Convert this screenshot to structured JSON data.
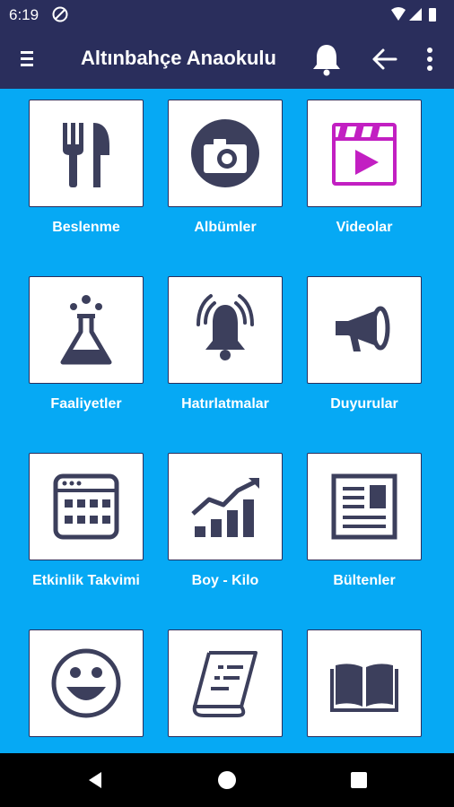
{
  "status_bar": {
    "time": "6:19"
  },
  "app_bar": {
    "title": "Altınbahçe Anaokulu"
  },
  "tiles": [
    {
      "label": "Beslenme",
      "icon": "fork-knife-icon"
    },
    {
      "label": "Albümler",
      "icon": "camera-icon"
    },
    {
      "label": "Videolar",
      "icon": "video-clapper-icon"
    },
    {
      "label": "Faaliyetler",
      "icon": "flask-icon"
    },
    {
      "label": "Hatırlatmalar",
      "icon": "alarm-bell-icon"
    },
    {
      "label": "Duyurular",
      "icon": "megaphone-icon"
    },
    {
      "label": "Etkinlik Takvimi",
      "icon": "calendar-icon"
    },
    {
      "label": "Boy - Kilo",
      "icon": "growth-chart-icon"
    },
    {
      "label": "Bültenler",
      "icon": "newsletter-icon"
    },
    {
      "label": "",
      "icon": "smiley-icon"
    },
    {
      "label": "",
      "icon": "scroll-icon"
    },
    {
      "label": "",
      "icon": "book-icon"
    }
  ],
  "colors": {
    "background": "#06A9F4",
    "bar": "#2A2E5C",
    "icon": "#3C3F5C",
    "video_accent": "#C21FC2"
  }
}
